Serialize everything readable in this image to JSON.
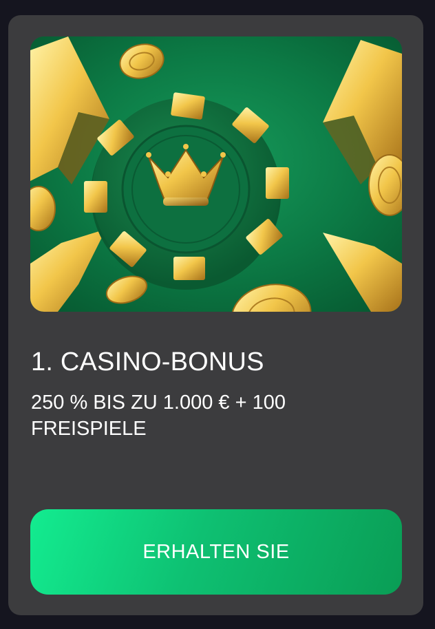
{
  "colors": {
    "page_background": "#15151f",
    "card_background": "#3c3c3e",
    "banner_green": "#0b6b3f",
    "gold": "#f2c64a",
    "cta_gradient_start": "#13ec90",
    "cta_gradient_end": "#0a9d55",
    "text": "#ffffff"
  },
  "banner": {
    "icons": [
      "casino-chip-icon",
      "crown-icon",
      "gold-coin-icon",
      "gold-arrow-icon"
    ]
  },
  "bonus": {
    "title": "1. CASINO-BONUS",
    "offer": "250 % BIS ZU 1.000 € + 100 FREISPIELE"
  },
  "cta": {
    "label": "ERHALTEN SIE"
  }
}
